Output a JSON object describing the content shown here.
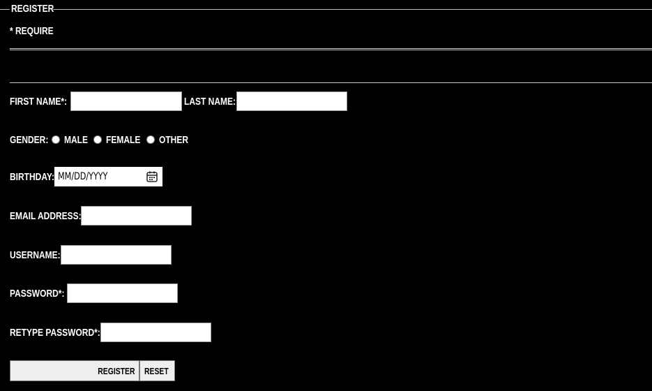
{
  "form": {
    "legend": "REGISTER",
    "require_note": "* REQUIRE",
    "first_name_label": "FIRST NAME*:",
    "last_name_label": "LAST NAME:",
    "gender_label": "GENDER:",
    "gender_options": [
      "MALE",
      "FEMALE",
      "OTHER"
    ],
    "birthday_label": "BIRTHDAY:",
    "birthday_placeholder": "MM/DD/YYYY",
    "email_label": "EMAIL ADDRESS:",
    "username_label": "USERNAME:",
    "password_label": "PASSWORD*:",
    "retype_password_label": "RETYPE PASSWORD*:",
    "register_button": "REGISTER",
    "reset_button": "RESET",
    "calendar_icon": "calendar-icon"
  }
}
